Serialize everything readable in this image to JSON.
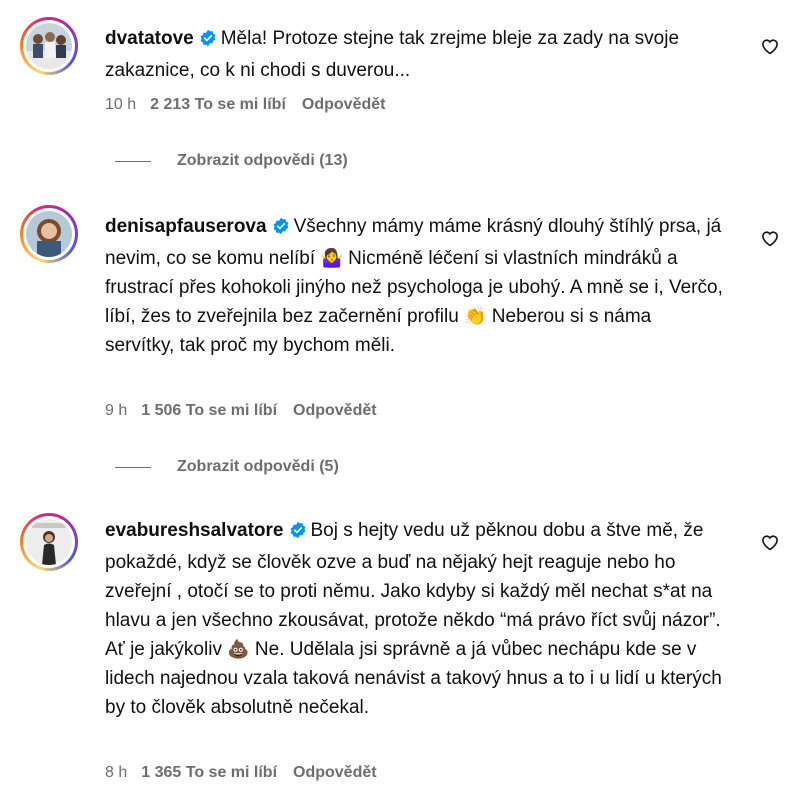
{
  "comments": [
    {
      "username": "dvatatove",
      "text": "Měla! Protoze stejne tak zrejme bleje za zady na svoje zakaznice, co k ni chodi s duverou...",
      "time": "10 h",
      "likes": "2 213 To se mi líbí",
      "reply_label": "Odpovědět",
      "view_replies": "Zobrazit odpovědi (13)"
    },
    {
      "username": "denisapfauserova",
      "text_parts": [
        "Všechny mámy máme krásný dlouhý štíhlý prsa, já nevim, co se komu nelíbí ",
        " Nicméně léčení si vlastních mindráků a frustrací přes kohokoli jinýho než psychologa je ubohý. A mně se i, Verčo, líbí, žes to zveřejnila bez začernění profilu ",
        " Neberou si s náma servítky, tak proč my bychom měli."
      ],
      "emojis": [
        "🤷‍♀️",
        "👏"
      ],
      "time": "9 h",
      "likes": "1 506 To se mi líbí",
      "reply_label": "Odpovědět",
      "view_replies": "Zobrazit odpovědi (5)"
    },
    {
      "username": "evabureshsalvatore",
      "text_parts": [
        "Boj s hejty vedu už pěknou dobu a štve mě, že pokaždé, když se člověk ozve a buď na nějaký hejt reaguje nebo ho zveřejní , otočí se to proti němu. Jako kdyby si každý měl nechat s*at na hlavu a jen všechno zkousávat, protože někdo “má právo říct svůj názor”. Ať je jakýkoliv ",
        " Ne. Udělala jsi správně a já vůbec nechápu kde se v lidech najednou vzala taková nenávist a takový hnus a to i u lidí u kterých by to člověk absolutně nečekal."
      ],
      "emojis": [
        "💩"
      ],
      "time": "8 h",
      "likes": "1 365 To se mi líbí",
      "reply_label": "Odpovědět"
    }
  ],
  "icons": {
    "verified": "verified-badge-icon",
    "like": "heart-outline-icon"
  },
  "colors": {
    "verified_blue": "#0095f6",
    "meta_gray": "#6e6e6e"
  }
}
